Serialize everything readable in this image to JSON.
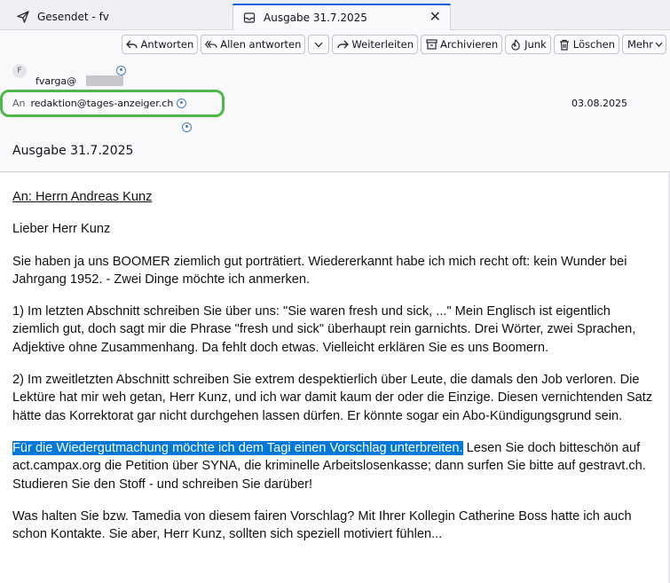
{
  "tabs": [
    {
      "label": "Gesendet - fv",
      "icon": "paper-plane-icon"
    },
    {
      "label": "Ausgabe 31.7.2025",
      "icon": "message-icon",
      "close": "✕"
    }
  ],
  "toolbar": {
    "reply": "Antworten",
    "reply_all": "Allen antworten",
    "forward": "Weiterleiten",
    "archive": "Archivieren",
    "junk": "Junk",
    "delete": "Löschen",
    "more": "Mehr"
  },
  "header": {
    "avatar_letter": "F",
    "from": "fvarga@",
    "to_label": "An",
    "to": "redaktion@tages-anzeiger.ch",
    "date": "03.08.2025",
    "subject": "Ausgabe 31.7.2025"
  },
  "body": {
    "addressee": "An: Herrn Andreas Kunz",
    "greeting": "Lieber Herr Kunz",
    "p1": "Sie haben ja uns BOOMER ziemlich gut porträtiert. Wiedererkannt habe ich mich recht oft: kein Wunder bei Jahrgang 1952.  - Zwei Dinge möchte ich anmerken.",
    "p2": "1) Im letzten Abschnitt schreiben Sie über uns: \"Sie waren fresh und sick, ...\" Mein Englisch ist eigentlich ziemlich gut, doch sagt mir die Phrase \"fresh und sick\" überhaupt rein garnichts. Drei Wörter, zwei Sprachen, Adjektive ohne Zusammenhang. Da fehlt doch etwas. Vielleicht erklären Sie es uns Boomern.",
    "p3": "2) Im zweitletzten Abschnitt schreiben Sie extrem despektierlich über Leute, die damals den Job verloren. Die Lektüre hat mir weh getan, Herr Kunz, und ich war damit kaum der oder die Einzige. Diesen vernichtenden Satz hätte das Korrektorat gar nicht durchgehen lassen dürfen. Er könnte sogar ein Abo-Kündigungsgrund sein.",
    "p4_selected": "Für die Wiedergutmachung möchte ich dem Tagi einen Vorschlag unterbreiten.",
    "p4_rest": " Lesen Sie doch bitteschön auf act.campax.org die Petition über SYNA, die kriminelle Arbeitslosenkasse; dann surfen Sie bitte auf gestravt.ch. Studieren Sie den Stoff - und schreiben Sie darüber!",
    "p5": "Was halten Sie bzw. Tamedia von diesem fairen Vorschlag? Mit Ihrer Kollegin Catherine Boss hatte ich auch schon Kontakte. Sie aber, Herr Kunz, sollten sich speziell motiviert fühlen..."
  },
  "colors": {
    "selection": "#0078d7",
    "accent": "#0061e0",
    "highlight_ring": "#4bb848"
  }
}
